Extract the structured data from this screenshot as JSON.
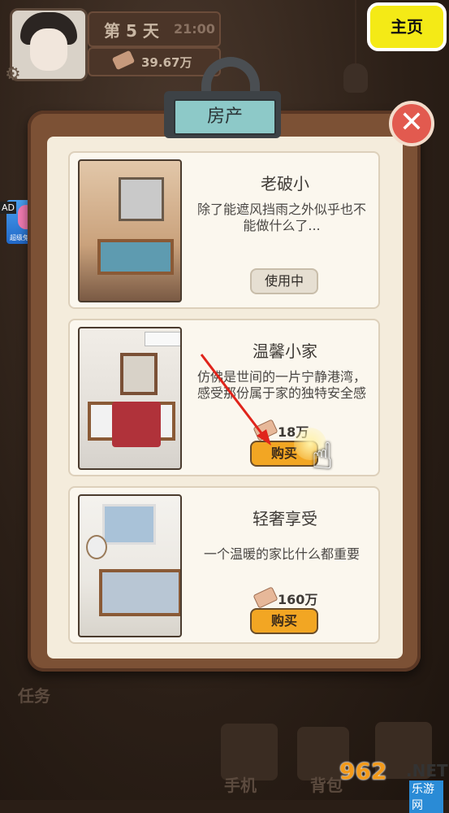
{
  "hud": {
    "day": "第 5 天",
    "time": "21:00",
    "money": "39.67万"
  },
  "home_button": "主页",
  "ad": {
    "badge": "AD",
    "app_name": "超级兔子人"
  },
  "panel": {
    "title": "房产"
  },
  "houses": [
    {
      "name": "老破小",
      "description": "除了能遮风挡雨之外似乎也不能做什么了...",
      "status": "使用中"
    },
    {
      "name": "温馨小家",
      "description": "仿佛是世间的一片宁静港湾，感受那份属于家的独特安全感",
      "price": "18万",
      "button": "购买"
    },
    {
      "name": "轻奢享受",
      "description": "一个温暖的家比什么都重要",
      "price": "160万",
      "button": "购买"
    }
  ],
  "bottom_bar": {
    "task": "任务",
    "phone": "手机",
    "backpack": "背包"
  },
  "watermark": {
    "number": "962",
    "dot": ".NET",
    "site": "乐游网"
  },
  "colors": {
    "home_button": "#f4ea16",
    "close_button": "#e25a4f",
    "buy_button": "#f2a623",
    "tutorial_arrow": "#e0241b"
  }
}
